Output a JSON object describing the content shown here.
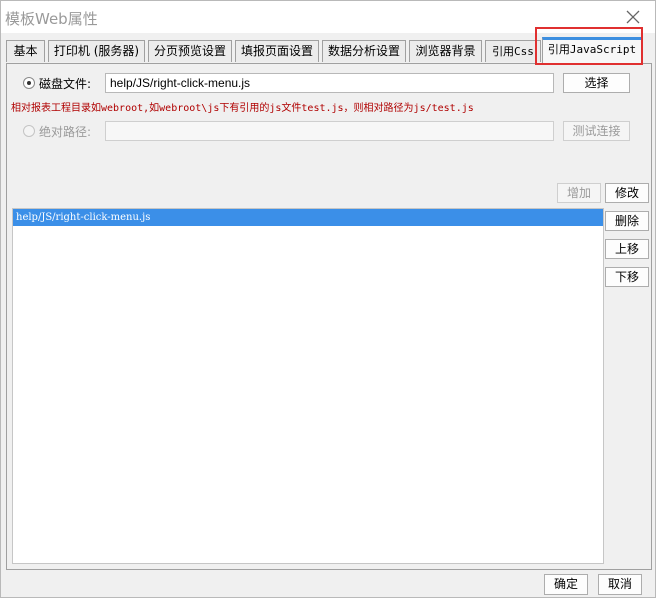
{
  "window": {
    "title": "模板Web属性"
  },
  "tabs": [
    {
      "label": "基本"
    },
    {
      "label": "打印机 (服务器)"
    },
    {
      "label": "分页预览设置"
    },
    {
      "label": "填报页面设置"
    },
    {
      "label": "数据分析设置"
    },
    {
      "label": "浏览器背景"
    },
    {
      "label": "引用Css"
    },
    {
      "label": "引用JavaScript",
      "active": true
    }
  ],
  "disk_file": {
    "label": "磁盘文件:",
    "selected": true,
    "value": "help/JS/right-click-menu.js",
    "choose_label": "选择"
  },
  "hint_text": "相对报表工程目录如webroot,如webroot\\js下有引用的js文件test.js，则相对路径为js/test.js",
  "absolute_path": {
    "label": "绝对路径:",
    "selected": false,
    "value": "",
    "test_label": "测试连接"
  },
  "list_actions": {
    "add": "增加",
    "modify": "修改",
    "delete": "删除",
    "move_up": "上移",
    "move_down": "下移"
  },
  "script_list": [
    {
      "path": "help/JS/right-click-menu.js",
      "selected": true
    }
  ],
  "footer": {
    "ok": "确定",
    "cancel": "取消"
  },
  "colors": {
    "selection": "#3b8fe8",
    "active_tab_accent": "#3d8fe0",
    "highlight_box": "#e03030",
    "hint_text": "#b00000"
  },
  "icons": {
    "close": "close-icon"
  }
}
